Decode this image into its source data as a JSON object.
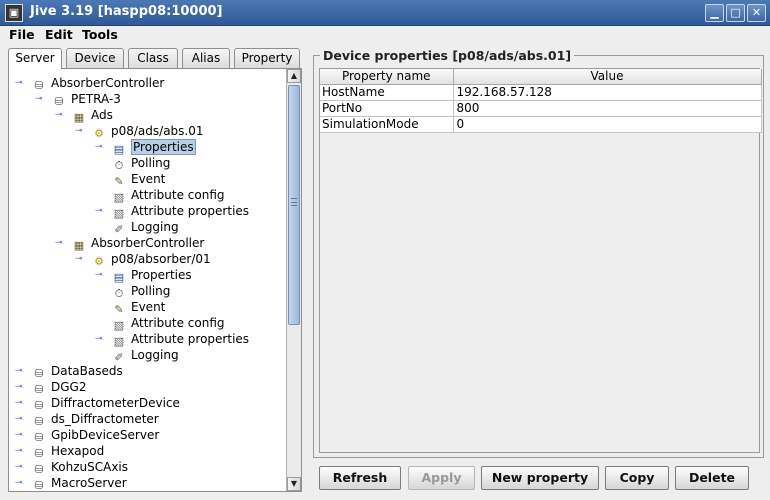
{
  "window": {
    "title": "Jive 3.19  [haspp08:10000]",
    "app_icon": "terminal-icon"
  },
  "menu": [
    "File",
    "Edit",
    "Tools"
  ],
  "tabs": [
    "Server",
    "Device",
    "Class",
    "Alias",
    "Property"
  ],
  "tree": [
    {
      "label": "AbsorberController",
      "icon": "server-icon",
      "depth": 0,
      "handle": "open"
    },
    {
      "label": "PETRA-3",
      "icon": "server-icon",
      "depth": 1,
      "handle": "open"
    },
    {
      "label": "Ads",
      "icon": "class-icon",
      "depth": 2,
      "handle": "open"
    },
    {
      "label": "p08/ads/abs.01",
      "icon": "device-icon",
      "depth": 3,
      "handle": "open"
    },
    {
      "label": "Properties",
      "icon": "properties-icon",
      "depth": 4,
      "handle": "closed",
      "selected": true
    },
    {
      "label": "Polling",
      "icon": "polling-icon",
      "depth": 4
    },
    {
      "label": "Event",
      "icon": "event-icon",
      "depth": 4
    },
    {
      "label": "Attribute config",
      "icon": "attribute-config-icon",
      "depth": 4
    },
    {
      "label": "Attribute properties",
      "icon": "attribute-properties-icon",
      "depth": 4,
      "handle": "closed"
    },
    {
      "label": "Logging",
      "icon": "logging-icon",
      "depth": 4
    },
    {
      "label": "AbsorberController",
      "icon": "class-icon",
      "depth": 2,
      "handle": "open"
    },
    {
      "label": "p08/absorber/01",
      "icon": "device-icon",
      "depth": 3,
      "handle": "open"
    },
    {
      "label": "Properties",
      "icon": "properties-icon",
      "depth": 4,
      "handle": "closed"
    },
    {
      "label": "Polling",
      "icon": "polling-icon",
      "depth": 4
    },
    {
      "label": "Event",
      "icon": "event-icon",
      "depth": 4
    },
    {
      "label": "Attribute config",
      "icon": "attribute-config-icon",
      "depth": 4
    },
    {
      "label": "Attribute properties",
      "icon": "attribute-properties-icon",
      "depth": 4,
      "handle": "closed"
    },
    {
      "label": "Logging",
      "icon": "logging-icon",
      "depth": 4
    },
    {
      "label": "DataBaseds",
      "icon": "server-icon",
      "depth": 0,
      "handle": "closed"
    },
    {
      "label": "DGG2",
      "icon": "server-icon",
      "depth": 0,
      "handle": "closed"
    },
    {
      "label": "DiffractometerDevice",
      "icon": "server-icon",
      "depth": 0,
      "handle": "closed"
    },
    {
      "label": "ds_Diffractometer",
      "icon": "server-icon",
      "depth": 0,
      "handle": "closed"
    },
    {
      "label": "GpibDeviceServer",
      "icon": "server-icon",
      "depth": 0,
      "handle": "closed"
    },
    {
      "label": "Hexapod",
      "icon": "server-icon",
      "depth": 0,
      "handle": "closed"
    },
    {
      "label": "KohzuSCAxis",
      "icon": "server-icon",
      "depth": 0,
      "handle": "closed"
    },
    {
      "label": "MacroServer",
      "icon": "server-icon",
      "depth": 0,
      "handle": "closed"
    }
  ],
  "properties": {
    "title": "Device properties [p08/ads/abs.01]",
    "columns": [
      "Property name",
      "Value"
    ],
    "rows": [
      {
        "name": "HostName",
        "value": "192.168.57.128"
      },
      {
        "name": "PortNo",
        "value": "800"
      },
      {
        "name": "SimulationMode",
        "value": "0"
      }
    ]
  },
  "buttons": [
    {
      "label": "Refresh",
      "enabled": true
    },
    {
      "label": "Apply",
      "enabled": false
    },
    {
      "label": "New property",
      "enabled": true
    },
    {
      "label": "Copy",
      "enabled": true
    },
    {
      "label": "Delete",
      "enabled": true
    }
  ]
}
